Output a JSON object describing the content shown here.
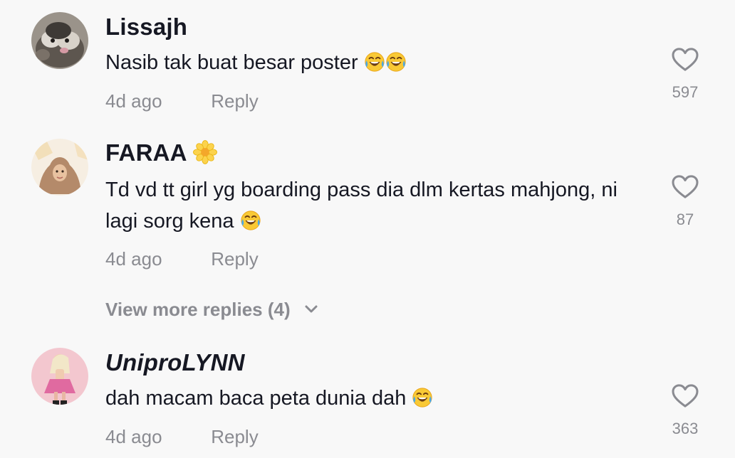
{
  "comments": [
    {
      "username": "Lissajh",
      "text": "Nasib tak buat besar poster ",
      "emoji": [
        "face-with-tears-of-joy",
        "face-with-tears-of-joy"
      ],
      "time": "4d ago",
      "reply_label": "Reply",
      "likes": "597"
    },
    {
      "username": "FARAA",
      "username_emoji": "blossom",
      "text": "Td vd tt girl yg boarding pass dia dlm kertas mahjong, ni lagi sorg kena ",
      "emoji": [
        "face-with-tears-of-joy"
      ],
      "time": "4d ago",
      "reply_label": "Reply",
      "likes": "87"
    },
    {
      "username": "UniproLYNN",
      "text": "dah macam baca peta dunia dah ",
      "emoji": [
        "face-with-tears-of-joy"
      ],
      "time": "4d ago",
      "reply_label": "Reply",
      "likes": "363"
    }
  ],
  "view_more_replies": "View more replies (4)",
  "colors": {
    "background": "#f8f8f8",
    "primary_text": "#161823",
    "secondary_text": "#8a8b91"
  }
}
